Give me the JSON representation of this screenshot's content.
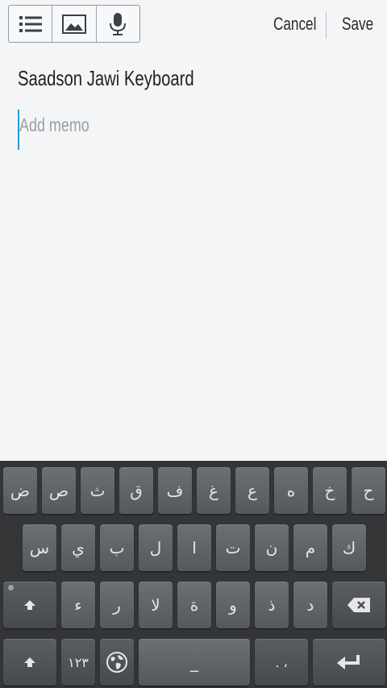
{
  "toolbar": {
    "tools": [
      "list-icon",
      "image-icon",
      "microphone-icon"
    ],
    "cancel_label": "Cancel",
    "save_label": "Save"
  },
  "note": {
    "title": "Saadson Jawi Keyboard",
    "memo_placeholder": "Add memo",
    "accent_color": "#2a9bd6"
  },
  "keyboard": {
    "row1": [
      "ض",
      "ص",
      "ث",
      "ق",
      "ف",
      "غ",
      "ع",
      "ه",
      "خ",
      "ح"
    ],
    "row2": [
      "س",
      "ي",
      "ب",
      "ل",
      "ا",
      "ت",
      "ن",
      "م",
      "ك"
    ],
    "row3": [
      "ء",
      "ر",
      "لا",
      "ة",
      "و",
      "ذ",
      "د"
    ],
    "numbers_label": "١٢٣",
    "space_label": "_",
    "punct_label": ". ،",
    "icons": [
      "shift-icon",
      "backspace-icon",
      "globe-icon",
      "enter-icon"
    ]
  }
}
